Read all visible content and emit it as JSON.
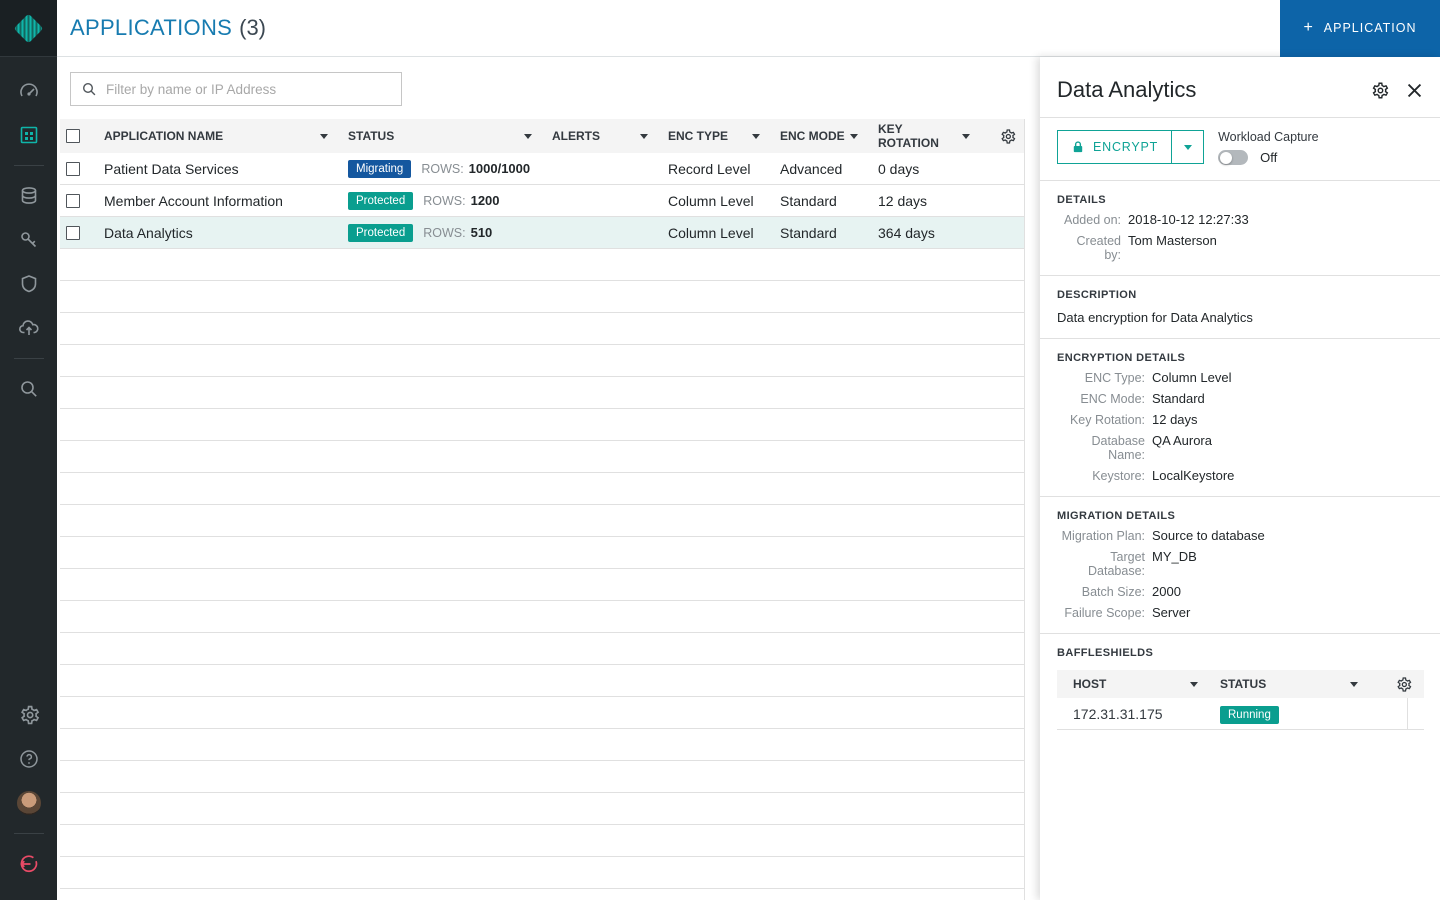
{
  "colors": {
    "accent_teal": "#0FA396",
    "active_icon_teal": "#0FB5AA",
    "badge_protected": "#0A9E8F",
    "badge_migrating": "#14579F",
    "badge_running": "#0A9E8F",
    "add_button_blue": "#0D64A8",
    "title_blue": "#177BB0",
    "logout_red": "#EA4B67",
    "selected_row_bg": "#E7F3F2"
  },
  "header": {
    "title": "APPLICATIONS",
    "count": "(3)",
    "add_button": {
      "plus": "+",
      "label": "APPLICATION"
    }
  },
  "filter": {
    "placeholder": "Filter by name or IP Address"
  },
  "table": {
    "columns": [
      "APPLICATION NAME",
      "STATUS",
      "ALERTS",
      "ENC TYPE",
      "ENC MODE",
      "KEY ROTATION"
    ],
    "rows_label": "ROWS:",
    "rows": [
      {
        "name": "Patient Data Services",
        "status": "Migrating",
        "rows": "1000/1000",
        "alerts": "",
        "enc_type": "Record Level",
        "enc_mode": "Advanced",
        "key_rotation": "0 days"
      },
      {
        "name": "Member Account Information",
        "status": "Protected",
        "rows": "1200",
        "alerts": "",
        "enc_type": "Column Level",
        "enc_mode": "Standard",
        "key_rotation": "12 days"
      },
      {
        "name": "Data Analytics",
        "status": "Protected",
        "rows": "510",
        "alerts": "",
        "enc_type": "Column Level",
        "enc_mode": "Standard",
        "key_rotation": "364 days"
      }
    ]
  },
  "panel": {
    "title": "Data Analytics",
    "encrypt_label": "ENCRYPT",
    "workload": {
      "label": "Workload Capture",
      "state": "Off"
    },
    "details": {
      "heading": "DETAILS",
      "fields": [
        {
          "label": "Added on:",
          "value": "2018-10-12 12:27:33"
        },
        {
          "label": "Created by:",
          "value": "Tom Masterson"
        }
      ]
    },
    "description": {
      "heading": "DESCRIPTION",
      "text": "Data encryption for Data Analytics"
    },
    "encryption": {
      "heading": "ENCRYPTION DETAILS",
      "fields": [
        {
          "label": "ENC Type:",
          "value": "Column Level"
        },
        {
          "label": "ENC Mode:",
          "value": "Standard"
        },
        {
          "label": "Key Rotation:",
          "value": "12 days"
        },
        {
          "label": "Database Name:",
          "value": "QA Aurora"
        },
        {
          "label": "Keystore:",
          "value": "LocalKeystore"
        }
      ]
    },
    "migration": {
      "heading": "MIGRATION DETAILS",
      "fields": [
        {
          "label": "Migration Plan:",
          "value": "Source to database"
        },
        {
          "label": "Target Database:",
          "value": "MY_DB"
        },
        {
          "label": "Batch Size:",
          "value": "2000"
        },
        {
          "label": "Failure Scope:",
          "value": "Server"
        }
      ]
    },
    "baffleshields": {
      "heading": "BAFFLESHIELDS",
      "columns": [
        "HOST",
        "STATUS"
      ],
      "rows": [
        {
          "host": "172.31.31.175",
          "status": "Running"
        }
      ]
    }
  }
}
